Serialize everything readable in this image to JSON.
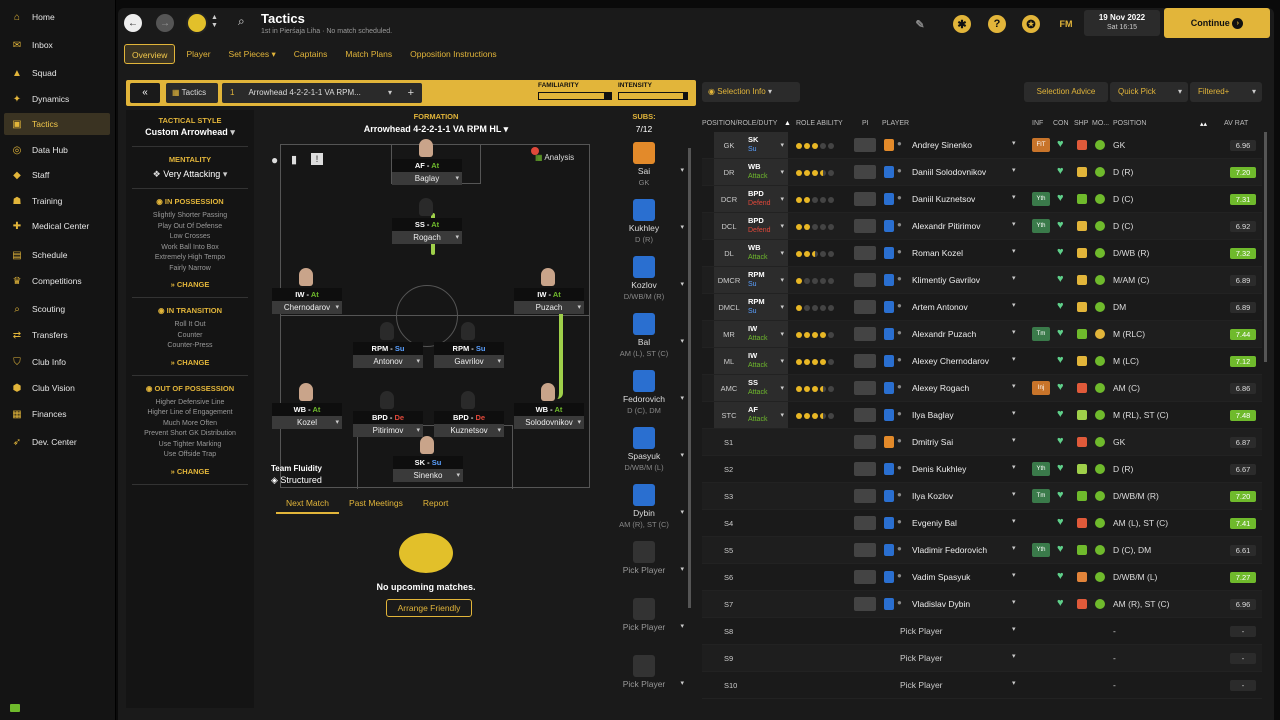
{
  "sidebar": {
    "items": [
      {
        "label": "Home",
        "icon": "home-icon"
      },
      {
        "label": "Inbox",
        "icon": "inbox-icon"
      },
      {
        "label": "Squad",
        "icon": "shirt-icon"
      },
      {
        "label": "Dynamics",
        "icon": "dynamics-icon"
      },
      {
        "label": "Tactics",
        "icon": "tactics-icon",
        "active": true
      },
      {
        "label": "Data Hub",
        "icon": "data-hub-icon"
      },
      {
        "label": "Staff",
        "icon": "staff-icon"
      },
      {
        "label": "Training",
        "icon": "training-icon"
      },
      {
        "label": "Medical Center",
        "icon": "medical-icon"
      },
      {
        "label": "Schedule",
        "icon": "calendar-icon"
      },
      {
        "label": "Competitions",
        "icon": "trophy-icon"
      },
      {
        "label": "Scouting",
        "icon": "scouting-icon"
      },
      {
        "label": "Transfers",
        "icon": "transfers-icon"
      },
      {
        "label": "Club Info",
        "icon": "shield-icon"
      },
      {
        "label": "Club Vision",
        "icon": "vision-icon"
      },
      {
        "label": "Finances",
        "icon": "finances-icon"
      },
      {
        "label": "Dev. Center",
        "icon": "dev-center-icon"
      }
    ]
  },
  "header": {
    "title": "Tactics",
    "subtitle": "1st in Pierśaja Liha · No match scheduled.",
    "fm": "FM",
    "date": "19 Nov 2022",
    "time": "Sat 16:15",
    "continue": "Continue"
  },
  "tabs": [
    "Overview",
    "Player",
    "Set Pieces ▾",
    "Captains",
    "Match Plans",
    "Opposition Instructions"
  ],
  "tacbar": {
    "tactics": "Tactics",
    "tactic_name": "Arrowhead 4-2-2-1-1 VA RPM...",
    "familiarity": "FAMILIARITY",
    "intensity": "INTENSITY"
  },
  "style": {
    "title": "TACTICAL STYLE",
    "name": "Custom Arrowhead",
    "mentality_title": "MENTALITY",
    "mentality": "Very Attacking",
    "possession_title": "IN POSSESSION",
    "possession": [
      "Slightly Shorter Passing",
      "Play Out Of Defense",
      "Low Crosses",
      "Work Ball Into Box",
      "Extremely High Tempo",
      "Fairly Narrow"
    ],
    "transition_title": "IN TRANSITION",
    "transition": [
      "Roll It Out",
      "Counter",
      "Counter-Press"
    ],
    "oop_title": "OUT OF POSSESSION",
    "oop": [
      "Higher Defensive Line",
      "Higher Line of Engagement",
      "Much More Often",
      "Prevent Short GK Distribution",
      "Use Tighter Marking",
      "Use Offside Trap"
    ],
    "change": "CHANGE"
  },
  "formation": {
    "title": "FORMATION",
    "name": "Arrowhead 4-2-2-1-1 VA RPM HL ▾",
    "analysis": "Analysis",
    "fluidity_title": "Team Fluidity",
    "fluidity": "Structured"
  },
  "pitch_players": [
    {
      "role": "AF",
      "duty": "At",
      "name": "Baglay"
    },
    {
      "role": "SS",
      "duty": "At",
      "name": "Rogach"
    },
    {
      "role": "IW",
      "duty": "At",
      "name": "Chernodarov"
    },
    {
      "role": "IW",
      "duty": "At",
      "name": "Puzach"
    },
    {
      "role": "RPM",
      "duty": "Su",
      "name": "Antonov"
    },
    {
      "role": "RPM",
      "duty": "Su",
      "name": "Gavrilov"
    },
    {
      "role": "WB",
      "duty": "At",
      "name": "Kozel"
    },
    {
      "role": "BPD",
      "duty": "De",
      "name": "Pitirimov"
    },
    {
      "role": "BPD",
      "duty": "De",
      "name": "Kuznetsov"
    },
    {
      "role": "WB",
      "duty": "At",
      "name": "Solodovnikov"
    },
    {
      "role": "SK",
      "duty": "Su",
      "name": "Sinenko"
    }
  ],
  "subs": {
    "title": "SUBS:",
    "count": "7/12",
    "list": [
      {
        "name": "Sai",
        "pos": "GK",
        "gk": true
      },
      {
        "name": "Kukhley",
        "pos": "D (R)"
      },
      {
        "name": "Kozlov",
        "pos": "D/WB/M (R)"
      },
      {
        "name": "Bal",
        "pos": "AM (L), ST (C)"
      },
      {
        "name": "Fedorovich",
        "pos": "D (C), DM"
      },
      {
        "name": "Spasyuk",
        "pos": "D/WB/M (L)"
      },
      {
        "name": "Dybin",
        "pos": "AM (R), ST (C)"
      },
      {
        "name": "Pick Player",
        "pos": "",
        "empty": true
      },
      {
        "name": "Pick Player",
        "pos": "",
        "empty": true
      },
      {
        "name": "Pick Player",
        "pos": "",
        "empty": true
      }
    ]
  },
  "match_tabs": [
    "Next Match",
    "Past Meetings",
    "Report"
  ],
  "next_match": {
    "message": "No upcoming matches.",
    "button": "Arrange Friendly"
  },
  "right": {
    "selection_info": "Selection Info",
    "advice": "Selection Advice",
    "quick_pick": "Quick Pick",
    "filter": "Filtered+",
    "headers": {
      "pos": "POSITION/ROLE/DUTY",
      "ability": "ROLE ABILITY",
      "pi": "PI",
      "player": "PLAYER",
      "inf": "INF",
      "con": "CON",
      "shp": "SHP",
      "mo": "MO...",
      "position": "POSITION",
      "avrat": "AV RAT"
    },
    "rows": [
      {
        "pos": "GK",
        "role": "SK",
        "duty": "Su",
        "dutyc": "#5aa0ff",
        "dots": [
          2,
          2,
          2,
          0,
          0
        ],
        "name": "Andrey Sinenko",
        "inf": "FIT",
        "infc": "#c8742a",
        "shp": "#e05a3a",
        "mo": "#6fba2c",
        "position": "GK",
        "rat": "6.96",
        "hi": false,
        "gk": true
      },
      {
        "pos": "DR",
        "role": "WB",
        "duty": "Attack",
        "dutyc": "#6fba2c",
        "dots": [
          2,
          2,
          2,
          1,
          0
        ],
        "name": "Daniil Solodovnikov",
        "inf": "",
        "shp": "#e2b53a",
        "mo": "#6fba2c",
        "position": "D (R)",
        "rat": "7.20",
        "hi": true
      },
      {
        "pos": "DCR",
        "role": "BPD",
        "duty": "Defend",
        "dutyc": "#e0483a",
        "dots": [
          2,
          2,
          0,
          0,
          0
        ],
        "name": "Daniil Kuznetsov",
        "inf": "Yth",
        "infc": "#3a7a4a",
        "shp": "#6fba2c",
        "mo": "#6fba2c",
        "position": "D (C)",
        "rat": "7.31",
        "hi": true
      },
      {
        "pos": "DCL",
        "role": "BPD",
        "duty": "Defend",
        "dutyc": "#e0483a",
        "dots": [
          2,
          2,
          0,
          0,
          0
        ],
        "name": "Alexandr Pitirimov",
        "inf": "Yth",
        "infc": "#3a7a4a",
        "shp": "#e2b53a",
        "mo": "#6fba2c",
        "position": "D (C)",
        "rat": "6.92",
        "hi": false
      },
      {
        "pos": "DL",
        "role": "WB",
        "duty": "Attack",
        "dutyc": "#6fba2c",
        "dots": [
          2,
          2,
          1,
          0,
          0
        ],
        "name": "Roman Kozel",
        "inf": "",
        "shp": "#e2b53a",
        "mo": "#6fba2c",
        "position": "D/WB (R)",
        "rat": "7.32",
        "hi": true
      },
      {
        "pos": "DMCR",
        "role": "RPM",
        "duty": "Su",
        "dutyc": "#5aa0ff",
        "dots": [
          2,
          0,
          0,
          0,
          0
        ],
        "name": "Klimentiy Gavrilov",
        "inf": "",
        "shp": "#e2b53a",
        "mo": "#6fba2c",
        "position": "M/AM (C)",
        "rat": "6.89",
        "hi": false
      },
      {
        "pos": "DMCL",
        "role": "RPM",
        "duty": "Su",
        "dutyc": "#5aa0ff",
        "dots": [
          2,
          0,
          0,
          0,
          0
        ],
        "name": "Artem Antonov",
        "inf": "",
        "shp": "#e2b53a",
        "mo": "#6fba2c",
        "position": "DM",
        "rat": "6.89",
        "hi": false
      },
      {
        "pos": "MR",
        "role": "IW",
        "duty": "Attack",
        "dutyc": "#6fba2c",
        "dots": [
          2,
          2,
          2,
          2,
          0
        ],
        "name": "Alexandr Puzach",
        "inf": "Tm",
        "infc": "#3a7a4a",
        "shp": "#6fba2c",
        "mo": "#e2b53a",
        "position": "M (RLC)",
        "rat": "7.44",
        "hi": true
      },
      {
        "pos": "ML",
        "role": "IW",
        "duty": "Attack",
        "dutyc": "#6fba2c",
        "dots": [
          2,
          2,
          2,
          2,
          0
        ],
        "name": "Alexey Chernodarov",
        "inf": "",
        "shp": "#e2b53a",
        "mo": "#6fba2c",
        "position": "M (LC)",
        "rat": "7.12",
        "hi": true
      },
      {
        "pos": "AMC",
        "role": "SS",
        "duty": "Attack",
        "dutyc": "#6fba2c",
        "dots": [
          2,
          2,
          2,
          1,
          0
        ],
        "name": "Alexey Rogach",
        "inf": "Inj",
        "infc": "#c8742a",
        "shp": "#e05a3a",
        "mo": "#6fba2c",
        "position": "AM (C)",
        "rat": "6.86",
        "hi": false
      },
      {
        "pos": "STC",
        "role": "AF",
        "duty": "Attack",
        "dutyc": "#6fba2c",
        "dots": [
          2,
          2,
          2,
          1,
          0
        ],
        "name": "Ilya Baglay",
        "inf": "",
        "shp": "#9fd04a",
        "mo": "#6fba2c",
        "position": "M (RL), ST (C)",
        "rat": "7.48",
        "hi": true
      },
      {
        "pos": "S1",
        "name": "Dmitriy Sai",
        "inf": "",
        "shp": "#e05a3a",
        "mo": "#6fba2c",
        "position": "GK",
        "rat": "6.87",
        "hi": false,
        "sub": true,
        "gk": true
      },
      {
        "pos": "S2",
        "name": "Denis Kukhley",
        "inf": "Yth",
        "infc": "#3a7a4a",
        "shp": "#9fd04a",
        "mo": "#6fba2c",
        "position": "D (R)",
        "rat": "6.67",
        "hi": false,
        "sub": true
      },
      {
        "pos": "S3",
        "name": "Ilya Kozlov",
        "inf": "Tm",
        "infc": "#3a7a4a",
        "shp": "#6fba2c",
        "mo": "#6fba2c",
        "position": "D/WB/M (R)",
        "rat": "7.20",
        "hi": true,
        "sub": true
      },
      {
        "pos": "S4",
        "name": "Evgeniy Bal",
        "inf": "",
        "shp": "#e05a3a",
        "mo": "#6fba2c",
        "position": "AM (L), ST (C)",
        "rat": "7.41",
        "hi": true,
        "sub": true
      },
      {
        "pos": "S5",
        "name": "Vladimir Fedorovich",
        "inf": "Yth",
        "infc": "#3a7a4a",
        "shp": "#6fba2c",
        "mo": "#6fba2c",
        "position": "D (C), DM",
        "rat": "6.61",
        "hi": false,
        "sub": true
      },
      {
        "pos": "S6",
        "name": "Vadim Spasyuk",
        "inf": "",
        "shp": "#e2843a",
        "mo": "#6fba2c",
        "position": "D/WB/M (L)",
        "rat": "7.27",
        "hi": true,
        "sub": true
      },
      {
        "pos": "S7",
        "name": "Vladislav Dybin",
        "inf": "",
        "shp": "#e05a3a",
        "mo": "#6fba2c",
        "position": "AM (R), ST (C)",
        "rat": "6.96",
        "hi": false,
        "sub": true
      },
      {
        "pos": "S8",
        "name": "Pick Player",
        "position": "-",
        "rat": "-",
        "empty": true,
        "sub": true
      },
      {
        "pos": "S9",
        "name": "Pick Player",
        "position": "-",
        "rat": "-",
        "empty": true,
        "sub": true
      },
      {
        "pos": "S10",
        "name": "Pick Player",
        "position": "-",
        "rat": "-",
        "empty": true,
        "sub": true
      }
    ]
  }
}
